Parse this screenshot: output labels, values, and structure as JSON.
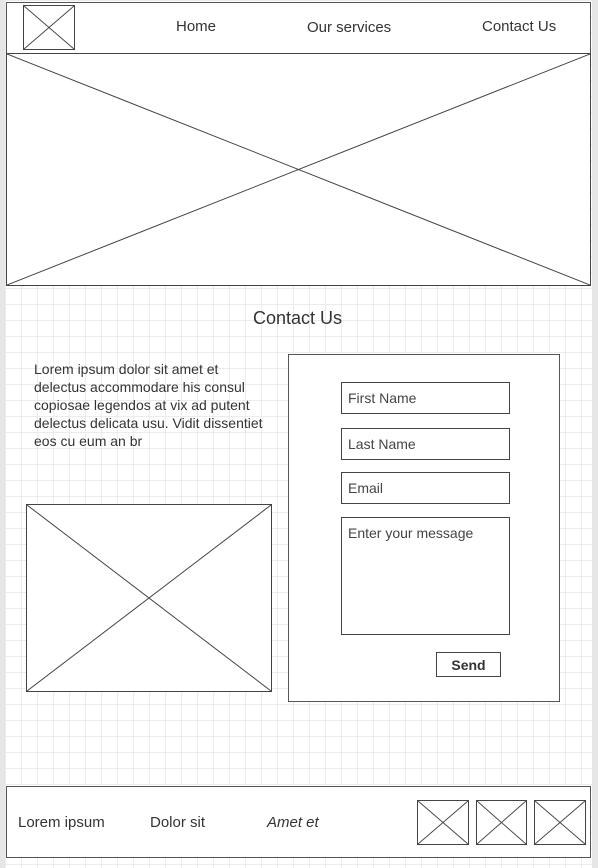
{
  "nav": {
    "home": "Home",
    "services": "Our services",
    "contact": "Contact Us"
  },
  "main": {
    "title": "Contact Us",
    "paragraph": "Lorem ipsum dolor sit amet et delectus accommodare his consul copiosae legendos at vix ad putent delectus delicata usu. Vidit dissentiet eos cu eum an br"
  },
  "form": {
    "first_name_placeholder": "First Name",
    "last_name_placeholder": "Last Name",
    "email_placeholder": "Email",
    "message_placeholder": "Enter your message",
    "send_label": "Send"
  },
  "footer": {
    "link1": "Lorem ipsum",
    "link2": "Dolor sit",
    "link3": "Amet et"
  },
  "icons": {
    "placeholder": "image-placeholder-icon"
  }
}
